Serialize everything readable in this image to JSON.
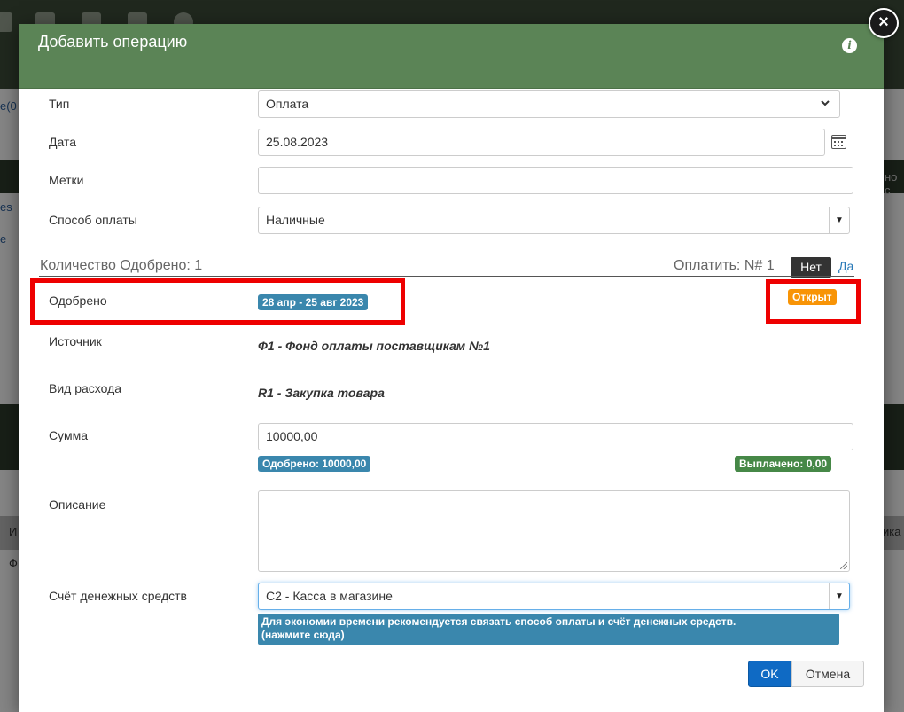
{
  "background": {
    "fragment_1": "e(0",
    "fragment_2": "es",
    "fragment_3": "e",
    "fragment_4": "но с",
    "fragment_5": "И",
    "fragment_6": "Ф",
    "fragment_7": "ика"
  },
  "modal": {
    "title": "Добавить операцию",
    "info_icon": "info-icon",
    "close_icon": "close-icon"
  },
  "form": {
    "type_label": "Тип",
    "type_value": "Оплата",
    "date_label": "Дата",
    "date_value": "25.08.2023",
    "tags_label": "Метки",
    "tags_value": "",
    "payment_method_label": "Способ оплаты",
    "payment_method_value": "Наличные"
  },
  "section": {
    "count_label": "Количество Одобрено: 1",
    "pay_label": "Оплатить: N# 1",
    "toggle_no": "Нет",
    "toggle_yes": "Да"
  },
  "approved": {
    "label": "Одобрено",
    "period_badge": "28 апр - 25 авг 2023",
    "status_badge": "Открыт"
  },
  "details": {
    "source_label": "Источник",
    "source_value": "Ф1 - Фонд оплаты поставщикам №1",
    "expense_label": "Вид расхода",
    "expense_value": "R1 - Закупка товара",
    "amount_label": "Сумма",
    "amount_value": "10000,00",
    "approved_amount": "Одобрено: 10000,00",
    "paid_amount": "Выплачено: 0,00",
    "description_label": "Описание",
    "description_value": "",
    "account_label": "Счёт денежных средств",
    "account_value": "C2 - Касса в магазине",
    "hint_line1": "Для экономии времени рекомендуется связать способ оплаты и счёт денежных средств.",
    "hint_line2": "(нажмите сюда)"
  },
  "buttons": {
    "ok": "OK",
    "cancel": "Отмена"
  },
  "colors": {
    "header_green": "#5b8456",
    "badge_blue": "#3a87ad",
    "badge_green": "#468847",
    "badge_orange": "#f89406",
    "highlight_red": "#e00000",
    "ok_blue": "#0f6ac4"
  }
}
